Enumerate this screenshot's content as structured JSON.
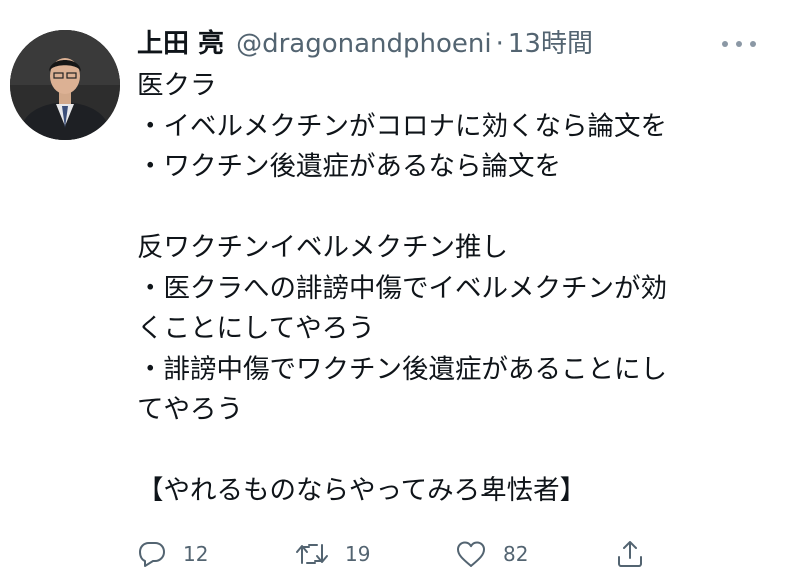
{
  "tweet": {
    "author_name": "上田 亮",
    "handle": "@dragonandphoeni",
    "separator": "·",
    "time": "13時間",
    "lines": [
      "医クラ",
      "・イベルメクチンがコロナに効くなら論文を",
      "・ワクチン後遺症があるなら論文を",
      "",
      "反ワクチンイベルメクチン推し",
      "・医クラへの誹謗中傷でイベルメクチンが効",
      "くことにしてやろう",
      "・誹謗中傷でワクチン後遺症があることにし",
      "てやろう",
      "",
      "【やれるものならやってみろ卑怯者】"
    ]
  },
  "actions": {
    "reply_icon": "reply-icon",
    "reply_count": "12",
    "retweet_icon": "retweet-icon",
    "retweet_count": "19",
    "like_icon": "heart-icon",
    "like_count": "82",
    "share_icon": "share-icon"
  },
  "colors": {
    "text": "#0f1419",
    "secondary": "#536471",
    "background": "#ffffff"
  }
}
